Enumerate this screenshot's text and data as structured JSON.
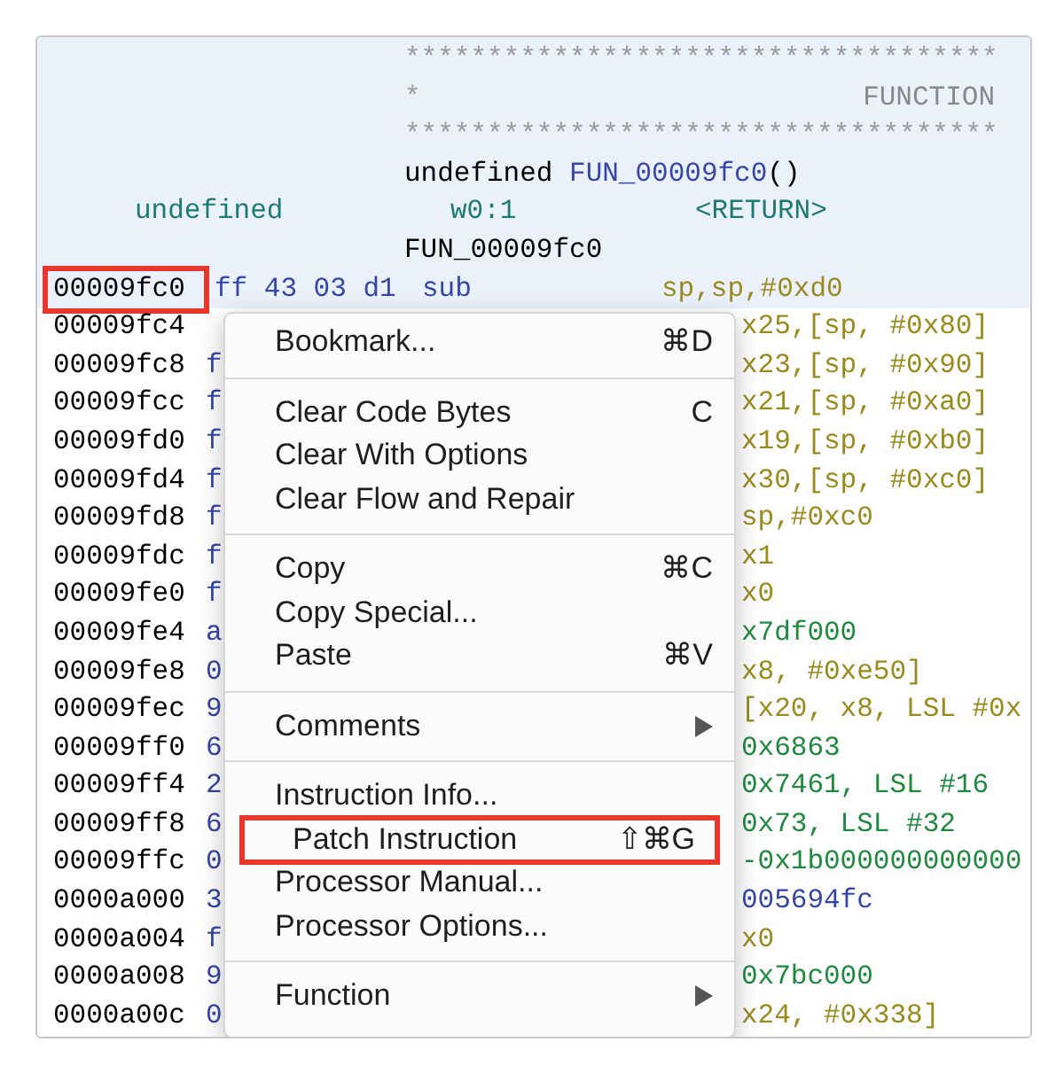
{
  "header": {
    "stars_top": "************************************",
    "banner_star": "*",
    "banner_title": "FUNCTION",
    "stars_bottom": "************************************",
    "signature_type": "undefined",
    "signature_name": "FUN_00009fc0",
    "signature_parens": "()",
    "return_type": "undefined",
    "return_storage": "w0:1",
    "return_name": "<RETURN>",
    "label": "FUN_00009fc0"
  },
  "rows": [
    {
      "address": "00009fc0",
      "bytes": "ff 43 03 d1",
      "mnemonic": "sub",
      "operands": "sp,sp,#0xd0",
      "color": "#9a8a1c",
      "selected": true,
      "marked": true
    },
    {
      "address": "00009fc4",
      "operands": "x25,[sp, #0x80]",
      "color": "#9a8a1c",
      "selected": false,
      "marked": false
    },
    {
      "address": "00009fc8",
      "bytes": "f",
      "operands": "x23,[sp, #0x90]",
      "color": "#9a8a1c",
      "selected": false,
      "marked": false
    },
    {
      "address": "00009fcc",
      "bytes": "f",
      "operands": "x21,[sp, #0xa0]",
      "color": "#9a8a1c",
      "selected": false,
      "marked": false
    },
    {
      "address": "00009fd0",
      "bytes": "f",
      "operands": "x19,[sp, #0xb0]",
      "color": "#9a8a1c",
      "selected": false,
      "marked": false
    },
    {
      "address": "00009fd4",
      "bytes": "f",
      "operands": "x30,[sp, #0xc0]",
      "color": "#9a8a1c",
      "selected": false,
      "marked": false
    },
    {
      "address": "00009fd8",
      "bytes": "f",
      "operands": "sp,#0xc0",
      "color": "#9a8a1c",
      "selected": false,
      "marked": false
    },
    {
      "address": "00009fdc",
      "bytes": "f",
      "operands": "x1",
      "color": "#9a8a1c",
      "selected": false,
      "marked": false
    },
    {
      "address": "00009fe0",
      "bytes": "f",
      "operands": "x0",
      "color": "#9a8a1c",
      "selected": false,
      "marked": false
    },
    {
      "address": "00009fe4",
      "bytes": "a",
      "operands": "x7df000",
      "color": "#1f8a3e",
      "selected": false,
      "marked": false
    },
    {
      "address": "00009fe8",
      "bytes": "0",
      "operands": "x8, #0xe50]",
      "color": "#9a8a1c",
      "selected": false,
      "marked": false
    },
    {
      "address": "00009fec",
      "bytes": "9",
      "operands": "[x20, x8, LSL #0x",
      "color": "#9a8a1c",
      "selected": false,
      "marked": false
    },
    {
      "address": "00009ff0",
      "bytes": "6",
      "operands": "0x6863",
      "color": "#1f8a3e",
      "selected": false,
      "marked": false
    },
    {
      "address": "00009ff4",
      "bytes": "2",
      "operands": "0x7461, LSL #16",
      "color": "#1f8a3e",
      "selected": false,
      "marked": false
    },
    {
      "address": "00009ff8",
      "bytes": "6",
      "operands": "0x73, LSL #32",
      "color": "#1f8a3e",
      "selected": false,
      "marked": false
    },
    {
      "address": "00009ffc",
      "bytes": "0",
      "operands": "-0x1b000000000000",
      "color": "#1f8a3e",
      "selected": false,
      "marked": false
    },
    {
      "address": "0000a000",
      "bytes": "3",
      "operands": "005694fc",
      "color": "#3545a8",
      "selected": false,
      "marked": false
    },
    {
      "address": "0000a004",
      "bytes": "f",
      "operands": "x0",
      "color": "#9a8a1c",
      "selected": false,
      "marked": false
    },
    {
      "address": "0000a008",
      "bytes": "9",
      "operands": "0x7bc000",
      "color": "#1f8a3e",
      "selected": false,
      "marked": false
    },
    {
      "address": "0000a00c",
      "bytes": "0",
      "operands": "x24, #0x338]",
      "color": "#9a8a1c",
      "selected": false,
      "marked": false
    }
  ],
  "context_menu": [
    {
      "kind": "item",
      "label": "Bookmark...",
      "shortcut": "⌘D",
      "submenu": false,
      "marked": false
    },
    {
      "kind": "separator"
    },
    {
      "kind": "item",
      "label": "Clear Code Bytes",
      "shortcut": "C",
      "submenu": false,
      "marked": false
    },
    {
      "kind": "item",
      "label": "Clear With Options",
      "submenu": false,
      "marked": false
    },
    {
      "kind": "item",
      "label": "Clear Flow and Repair",
      "submenu": false,
      "marked": false
    },
    {
      "kind": "separator"
    },
    {
      "kind": "item",
      "label": "Copy",
      "shortcut": "⌘C",
      "submenu": false,
      "marked": false
    },
    {
      "kind": "item",
      "label": "Copy Special...",
      "submenu": false,
      "marked": false
    },
    {
      "kind": "item",
      "label": "Paste",
      "shortcut": "⌘V",
      "submenu": false,
      "marked": false
    },
    {
      "kind": "separator"
    },
    {
      "kind": "item",
      "label": "Comments",
      "submenu": true,
      "marked": false
    },
    {
      "kind": "separator"
    },
    {
      "kind": "item",
      "label": "Instruction Info...",
      "submenu": false,
      "marked": false
    },
    {
      "kind": "item",
      "label": "Patch Instruction",
      "shortcut": "⇧⌘G",
      "submenu": false,
      "marked": true
    },
    {
      "kind": "item",
      "label": "Processor Manual...",
      "submenu": false,
      "marked": false
    },
    {
      "kind": "item",
      "label": "Processor Options...",
      "submenu": false,
      "marked": false
    },
    {
      "kind": "separator"
    },
    {
      "kind": "item",
      "label": "Function",
      "submenu": true,
      "marked": false
    }
  ]
}
